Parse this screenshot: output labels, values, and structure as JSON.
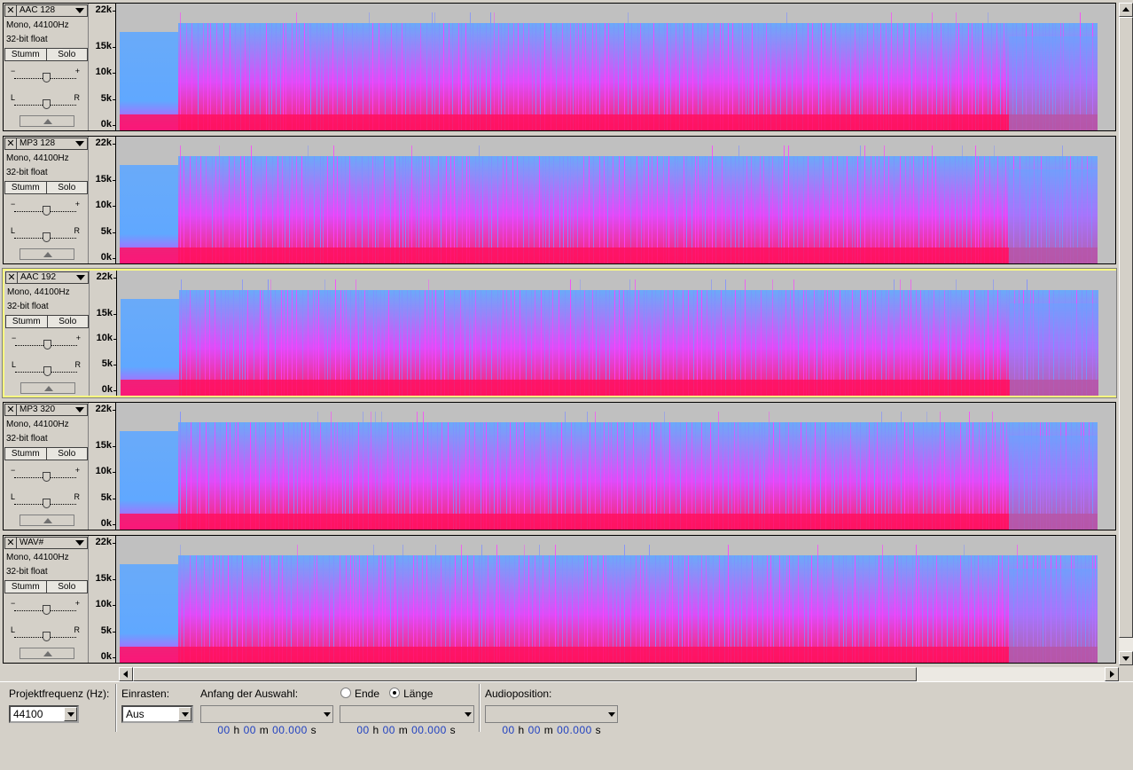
{
  "tracks": [
    {
      "name": "AAC 128",
      "selected": false
    },
    {
      "name": "MP3 128",
      "selected": false
    },
    {
      "name": "AAC 192",
      "selected": true
    },
    {
      "name": "MP3 320",
      "selected": false
    },
    {
      "name": "WAV#",
      "selected": false
    }
  ],
  "track_info": {
    "line1": "Mono, 44100Hz",
    "line2": "32-bit float"
  },
  "track_buttons": {
    "mute": "Stumm",
    "solo": "Solo"
  },
  "slider_labels": {
    "gain_min": "−",
    "gain_max": "+",
    "pan_left": "L",
    "pan_right": "R"
  },
  "close_glyph": "✕",
  "freq_axis": {
    "labels": [
      "22k",
      "15k",
      "10k",
      "5k",
      "0k"
    ],
    "values": [
      22050,
      15000,
      10000,
      5000,
      0
    ]
  },
  "colors": {
    "spectrum_low": "#ff1060",
    "spectrum_mid": "#e040ff",
    "spectrum_high": "#60a8ff",
    "empty": "#c0c0c0",
    "selection_border": "#ffff80"
  },
  "statusbar": {
    "project_rate_label": "Projektfrequenz (Hz):",
    "project_rate_value": "44100",
    "snap_label": "Einrasten:",
    "snap_value": "Aus",
    "selection_start_label": "Anfang der Auswahl:",
    "end_label": "Ende",
    "length_label": "Länge",
    "length_selected": true,
    "audio_position_label": "Audioposition:",
    "time_digits": {
      "h": "00",
      "m": "00",
      "s": "00.000"
    },
    "time_units": {
      "h": "h",
      "m": "m",
      "s": "s"
    }
  }
}
